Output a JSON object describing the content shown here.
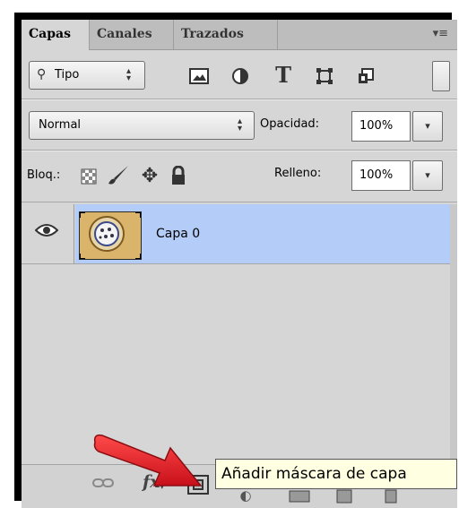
{
  "tabs": [
    {
      "label": "Capas",
      "active": true
    },
    {
      "label": "Canales",
      "active": false
    },
    {
      "label": "Trazados",
      "active": false
    }
  ],
  "panel_menu_icon": "panel-menu-icon",
  "filter": {
    "kind_label": "Tipo",
    "filter_icons": [
      "pixel-layer-filter-icon",
      "adjustment-layer-filter-icon",
      "type-layer-filter-icon",
      "shape-layer-filter-icon",
      "smart-object-filter-icon"
    ]
  },
  "blend": {
    "mode_value": "Normal",
    "opacity_label": "Opacidad:",
    "opacity_value": "100%"
  },
  "lock": {
    "label": "Bloq.:",
    "fill_label": "Relleno:",
    "fill_value": "100%"
  },
  "layers": [
    {
      "name": "Capa 0",
      "visible": true,
      "selected": true
    }
  ],
  "bottom_icons": [
    "link-layers-icon",
    "fx-icon",
    "add-mask-icon",
    "adjustment-layer-icon",
    "group-icon",
    "new-layer-icon",
    "delete-layer-icon"
  ],
  "tooltip": "Añadir máscara de capa",
  "colors": {
    "panel_bg": "#d6d6d6",
    "selected_layer": "#b4cdf8",
    "tooltip_bg": "#ffffe1",
    "arrow": "#e8202a"
  }
}
